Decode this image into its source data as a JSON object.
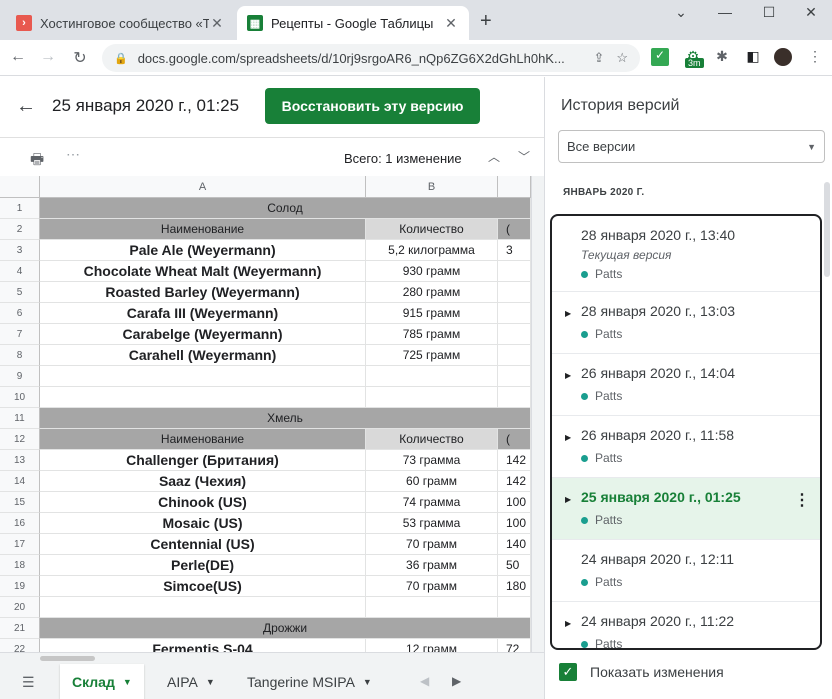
{
  "browser": {
    "tabs": [
      {
        "title": "Хостинговое сообщество «Time",
        "active": false,
        "favicon_color": "#e8594f"
      },
      {
        "title": "Рецепты - Google Таблицы",
        "active": true,
        "favicon_color": "#188038"
      }
    ],
    "url": "docs.google.com/spreadsheets/d/10rj9srgoAR6_nQp6ZG6X2dGhLh0hK...",
    "ext_badge": "3m"
  },
  "version_header": {
    "title": "25 января 2020 г., 01:25",
    "restore_label": "Восстановить эту версию",
    "changes_text": "Всего: 1 изменение"
  },
  "grid": {
    "columns": [
      "A",
      "B"
    ],
    "rows": [
      {
        "n": "1",
        "type": "section",
        "a": "Солод"
      },
      {
        "n": "2",
        "type": "header",
        "a": "Наименование",
        "b": "Количество",
        "c": "("
      },
      {
        "n": "3",
        "type": "data",
        "a": "Pale Ale (Weyermann)",
        "b": "5,2 килограмма",
        "c": "3"
      },
      {
        "n": "4",
        "type": "data",
        "a": "Chocolate Wheat Malt (Weyermann)",
        "b": "930 грамм",
        "c": ""
      },
      {
        "n": "5",
        "type": "data",
        "a": "Roasted Barley (Weyermann)",
        "b": "280 грамм",
        "c": ""
      },
      {
        "n": "6",
        "type": "data",
        "a": "Carafa III (Weyermann)",
        "b": "915 грамм",
        "c": ""
      },
      {
        "n": "7",
        "type": "data",
        "a": "Carabelge (Weyermann)",
        "b": "785 грамм",
        "c": ""
      },
      {
        "n": "8",
        "type": "data",
        "a": "Carahell (Weyermann)",
        "b": "725 грамм",
        "c": ""
      },
      {
        "n": "9",
        "type": "empty"
      },
      {
        "n": "10",
        "type": "empty"
      },
      {
        "n": "11",
        "type": "section",
        "a": "Хмель"
      },
      {
        "n": "12",
        "type": "header",
        "a": "Наименование",
        "b": "Количество",
        "c": "("
      },
      {
        "n": "13",
        "type": "data",
        "a": "Challenger (Британия)",
        "b": "73 грамма",
        "c": "142"
      },
      {
        "n": "14",
        "type": "data",
        "a": "Saaz (Чехия)",
        "b": "60 грамм",
        "c": "142"
      },
      {
        "n": "15",
        "type": "data",
        "a": "Chinook (US)",
        "b": "74 грамма",
        "c": "100"
      },
      {
        "n": "16",
        "type": "data",
        "a": "Mosaic (US)",
        "b": "53 грамма",
        "c": "100"
      },
      {
        "n": "17",
        "type": "data",
        "a": "Centennial (US)",
        "b": "70 грамм",
        "c": "140"
      },
      {
        "n": "18",
        "type": "data",
        "a": "Perle(DE)",
        "b": "36 грамм",
        "c": "50"
      },
      {
        "n": "19",
        "type": "data",
        "a": "Simcoe(US)",
        "b": "70 грамм",
        "c": "180"
      },
      {
        "n": "20",
        "type": "empty"
      },
      {
        "n": "21",
        "type": "section",
        "a": "Дрожжи"
      },
      {
        "n": "22",
        "type": "data",
        "a": "Fermentis S-04",
        "b": "12 грамм",
        "c": "72"
      }
    ]
  },
  "sheets": {
    "tabs": [
      {
        "label": "Склад",
        "active": true
      },
      {
        "label": "AIPA",
        "active": false
      },
      {
        "label": "Tangerine MSIPA",
        "active": false
      }
    ]
  },
  "history": {
    "title": "История версий",
    "filter": "Все версии",
    "month": "ЯНВАРЬ 2020 Г.",
    "versions": [
      {
        "when": "28 января 2020 г., 13:40",
        "note": "Текущая версия",
        "author": "Patts",
        "expandable": false,
        "selected": false
      },
      {
        "when": "28 января 2020 г., 13:03",
        "note": "",
        "author": "Patts",
        "expandable": true,
        "selected": false
      },
      {
        "when": "26 января 2020 г., 14:04",
        "note": "",
        "author": "Patts",
        "expandable": true,
        "selected": false
      },
      {
        "when": "26 января 2020 г., 11:58",
        "note": "",
        "author": "Patts",
        "expandable": true,
        "selected": false
      },
      {
        "when": "25 января 2020 г., 01:25",
        "note": "",
        "author": "Patts",
        "expandable": true,
        "selected": true
      },
      {
        "when": "24 января 2020 г., 12:11",
        "note": "",
        "author": "Patts",
        "expandable": false,
        "selected": false
      },
      {
        "when": "24 января 2020 г., 11:22",
        "note": "",
        "author": "Patts",
        "expandable": true,
        "selected": false
      }
    ],
    "show_changes_label": "Показать изменения",
    "show_changes_checked": true
  }
}
